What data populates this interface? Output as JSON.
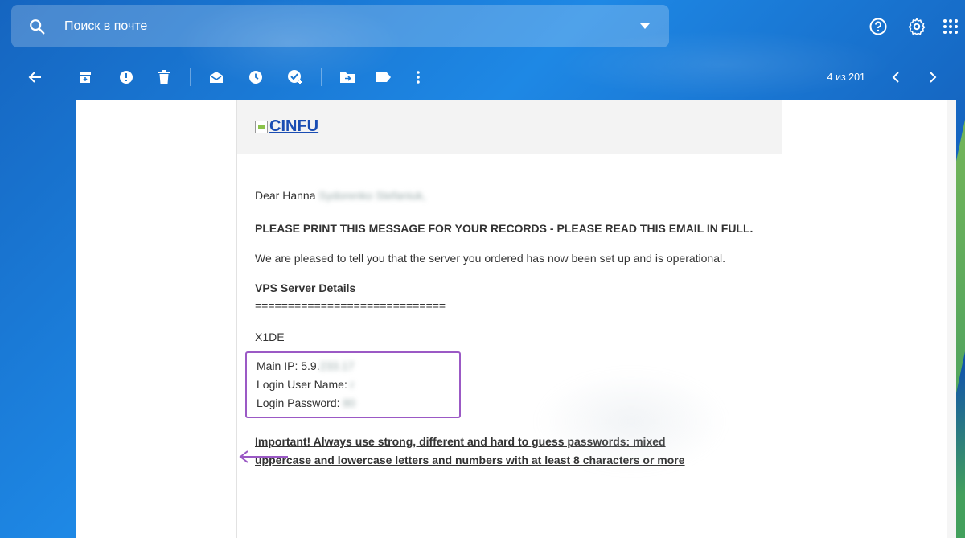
{
  "search": {
    "placeholder": "Поиск в почте",
    "icons": [
      "search-icon",
      "dropdown-caret-icon"
    ]
  },
  "top_icons": [
    "help-icon",
    "settings-gear-icon",
    "apps-grid-icon"
  ],
  "toolbar": {
    "buttons": [
      "back-arrow-icon",
      "archive-icon",
      "report-spam-icon",
      "delete-icon",
      "mark-unread-icon",
      "snooze-icon",
      "add-task-icon",
      "move-to-icon",
      "label-icon",
      "more-icon"
    ],
    "count": "4 из 201"
  },
  "email": {
    "logo_text": "CINFU",
    "greeting": "Dear Hanna",
    "greeting_blurred": "Sydorenko Stefaniuk,",
    "heading": "PLEASE PRINT THIS MESSAGE FOR YOUR RECORDS - PLEASE READ THIS EMAIL IN FULL.",
    "intro": "We are pleased to tell you that the server you ordered has now been set up and is operational.",
    "section_title": "VPS Server Details",
    "separator": "=============================",
    "server_name": "X1DE",
    "main_ip_label": "Main IP: 5.9.",
    "main_ip_blurred": "233.17",
    "login_user_label": "Login User Name:",
    "login_user_blurred": "r",
    "login_password_label": "Login Password:",
    "login_password_blurred": "80",
    "important_line1": "Important! Always use strong, different and hard to guess passwords: mixed",
    "important_line2": "uppercase and lowercase letters and numbers with at least 8 characters or more"
  },
  "colors": {
    "highlight_box": "#9b59c5",
    "link": "#1a4db3"
  }
}
